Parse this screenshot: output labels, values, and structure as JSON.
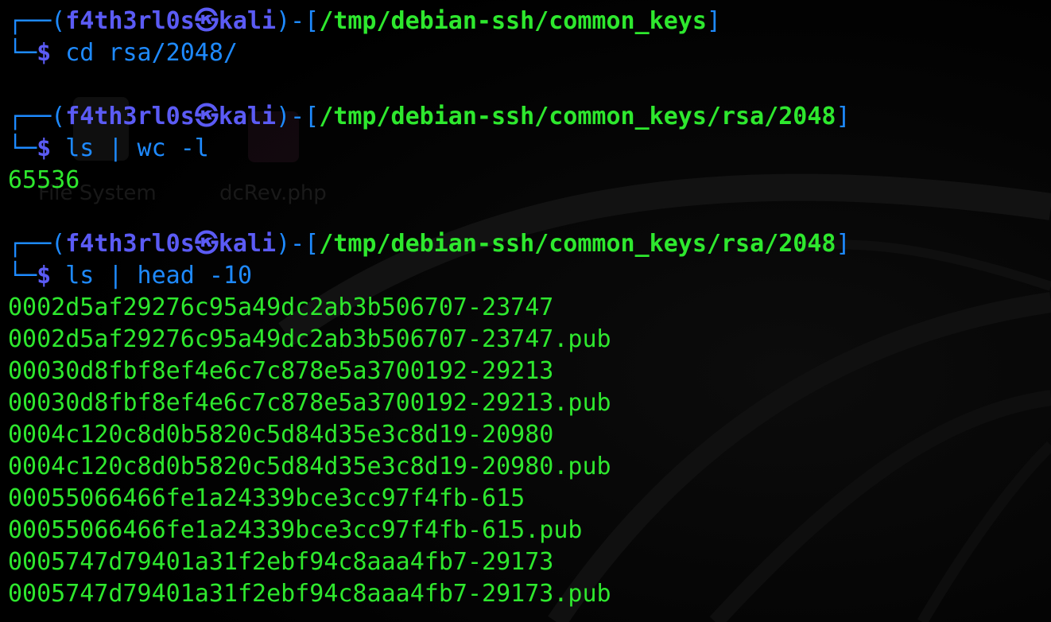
{
  "colors": {
    "background": "#000000",
    "prompt_frame": "#1E8AFF",
    "user_host": "#5B5BF5",
    "path": "#2EE82E",
    "command": "#1E8AFF",
    "output": "#2EE82E"
  },
  "desktop_ghosts": {
    "file_system_label": "File System",
    "dcrev_label": "dcRev.php",
    "file_system_icon": "folder-icon",
    "dcrev_icon": "php-file-icon"
  },
  "blocks": [
    {
      "user": "f4th3rl0s",
      "at_symbol": "㉿",
      "host": "kali",
      "path": "/tmp/debian-ssh/common_keys",
      "command": "cd rsa/2048/",
      "output": []
    },
    {
      "user": "f4th3rl0s",
      "at_symbol": "㉿",
      "host": "kali",
      "path": "/tmp/debian-ssh/common_keys/rsa/2048",
      "command": "ls | wc -l",
      "output": [
        "65536"
      ]
    },
    {
      "user": "f4th3rl0s",
      "at_symbol": "㉿",
      "host": "kali",
      "path": "/tmp/debian-ssh/common_keys/rsa/2048",
      "command": "ls | head -10",
      "output": [
        "0002d5af29276c95a49dc2ab3b506707-23747",
        "0002d5af29276c95a49dc2ab3b506707-23747.pub",
        "00030d8fbf8ef4e6c7c878e5a3700192-29213",
        "00030d8fbf8ef4e6c7c878e5a3700192-29213.pub",
        "0004c120c8d0b5820c5d84d35e3c8d19-20980",
        "0004c120c8d0b5820c5d84d35e3c8d19-20980.pub",
        "00055066466fe1a24339bce3cc97f4fb-615",
        "00055066466fe1a24339bce3cc97f4fb-615.pub",
        "0005747d79401a31f2ebf94c8aaa4fb7-29173",
        "0005747d79401a31f2ebf94c8aaa4fb7-29173.pub"
      ]
    }
  ]
}
